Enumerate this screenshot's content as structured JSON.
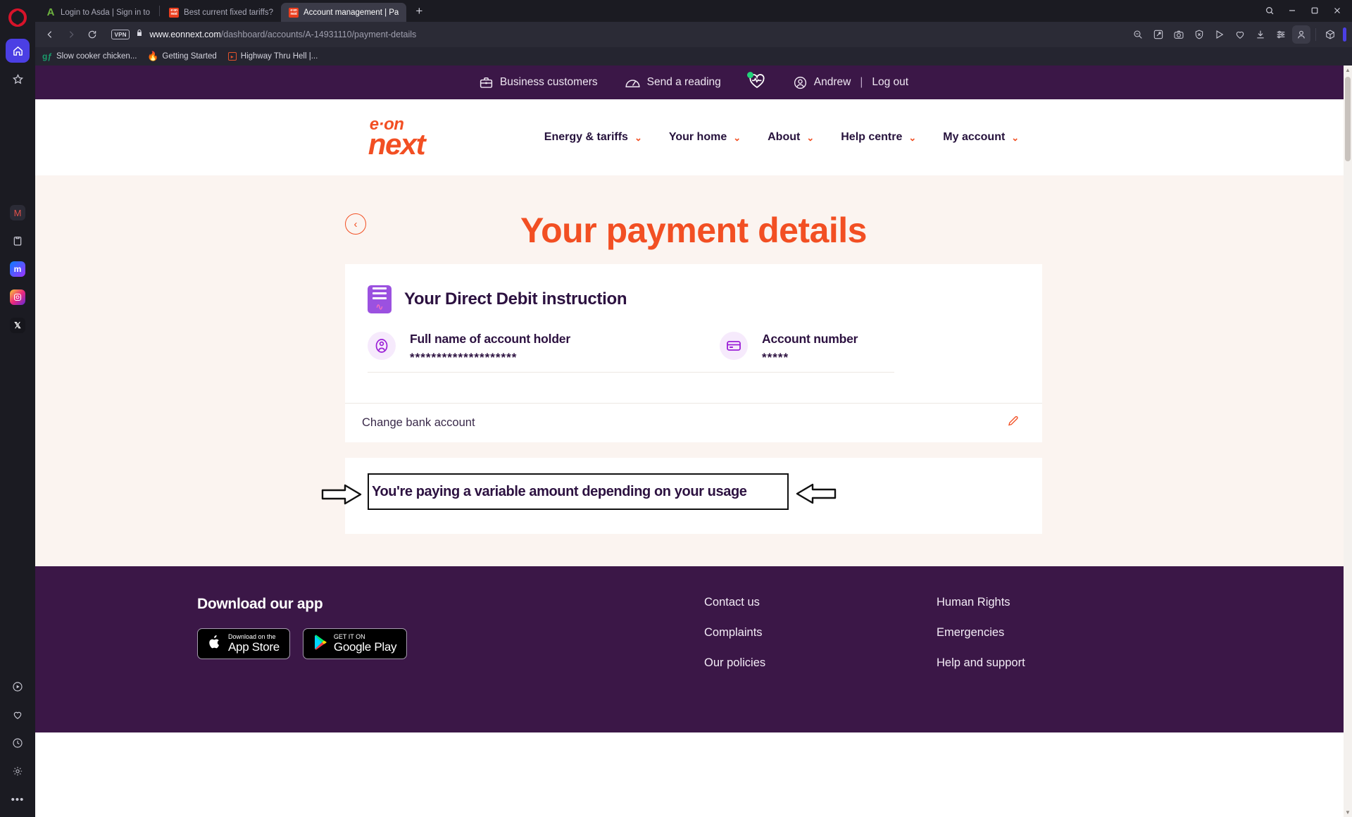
{
  "browser": {
    "name": "Opera",
    "sidebar_icons": [
      "opera-logo",
      "home-icon",
      "star-icon",
      "pinboard-icon",
      "clipboard-icon",
      "messenger-icon",
      "instagram-icon",
      "x-twitter-icon",
      "player-icon",
      "heart-icon",
      "history-icon",
      "settings-icon",
      "more-icon"
    ],
    "tabs": [
      {
        "title": "Login to Asda | Sign in to",
        "favicon": "asda-icon",
        "active": false
      },
      {
        "title": "Best current fixed tariffs?",
        "favicon": "eon-next-icon",
        "active": false
      },
      {
        "title": "Account management | Pa",
        "favicon": "eon-next-icon",
        "active": true
      }
    ],
    "new_tab_label": "+",
    "window_controls": {
      "search": "⌕",
      "minimize": "—",
      "maximize": "❐",
      "close": "✕"
    },
    "nav": {
      "back": "‹",
      "forward": "›",
      "reload": "⟳"
    },
    "address": {
      "vpn_badge": "VPN",
      "lock": "padlock-icon",
      "host": "www.eonnext.com",
      "path": "/dashboard/accounts/A-14931110/payment-details"
    },
    "toolbar_icons": [
      "zoom-out-icon",
      "edit-snapshot-icon",
      "camera-icon",
      "shield-block-icon",
      "send-icon",
      "heart-icon",
      "download-icon",
      "easy-setup-icon",
      "profile-icon",
      "crypto-wallet-icon"
    ],
    "bookmarks": [
      {
        "label": "Slow cooker chicken...",
        "favicon": "google-docs-icon"
      },
      {
        "label": "Getting Started",
        "favicon": "firefox-icon"
      },
      {
        "label": "Highway Thru Hell |...",
        "favicon": "video-icon"
      }
    ]
  },
  "site": {
    "utility_bar": {
      "business_customers": "Business customers",
      "send_a_reading": "Send a reading",
      "heart_icon": "heartbeat-icon",
      "user_name": "Andrew",
      "separator": "|",
      "log_out": "Log out"
    },
    "logo": {
      "top": "e·on",
      "bottom": "next"
    },
    "nav_links": [
      {
        "label": "Energy & tariffs",
        "has_chevron": true
      },
      {
        "label": "Your home",
        "has_chevron": true
      },
      {
        "label": "About",
        "has_chevron": true
      },
      {
        "label": "Help centre",
        "has_chevron": true
      },
      {
        "label": "My account",
        "has_chevron": true
      }
    ],
    "chevron_glyph": "⌄",
    "back_glyph": "‹"
  },
  "main": {
    "page_title": "Your payment details",
    "direct_debit_card": {
      "heading": "Your Direct Debit instruction",
      "fields": [
        {
          "label": "Full name of account holder",
          "value": "********************",
          "icon": "user-circle-icon"
        },
        {
          "label": "Account number",
          "value": "*****",
          "icon": "card-icon"
        }
      ],
      "change_row": {
        "label": "Change bank account",
        "icon": "pencil-icon"
      }
    },
    "variable_card": {
      "message": "You're paying a variable amount depending on your usage",
      "annotation": "black-box-with-arrows"
    }
  },
  "footer": {
    "app_heading": "Download our app",
    "badges": [
      {
        "sub": "Download on the",
        "main": "App Store",
        "icon": "apple-icon"
      },
      {
        "sub": "GET IT ON",
        "main": "Google Play",
        "icon": "google-play-icon"
      }
    ],
    "links_col1": [
      "Contact us",
      "Complaints",
      "Our policies"
    ],
    "links_col2": [
      "Human Rights",
      "Emergencies",
      "Help and support"
    ]
  },
  "colors": {
    "eon_orange": "#f24f23",
    "eon_purple": "#3b1747",
    "cream": "#fbf4f0",
    "accent_violet": "#9b51e0",
    "opera_red": "#d8132a",
    "status_green": "#22d37a"
  }
}
